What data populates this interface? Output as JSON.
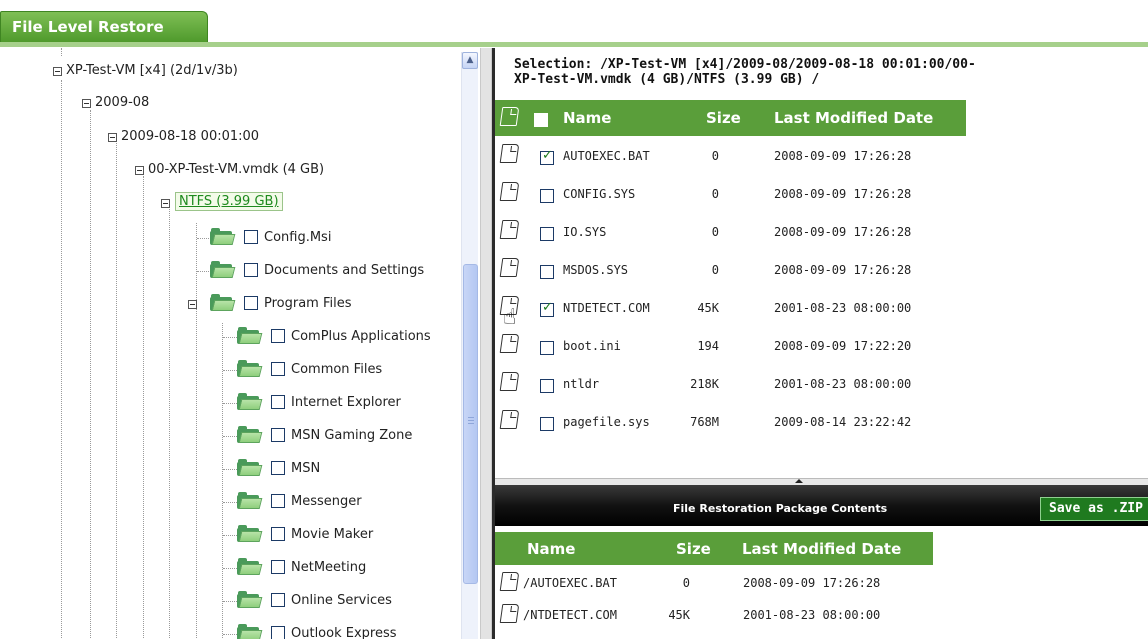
{
  "app": {
    "tab_label": "File Level Restore"
  },
  "tree": {
    "vm": "XP-Test-VM [x4] (2d/1v/3b)",
    "month": "2009-08",
    "snapshot": "2009-08-18 00:01:00",
    "disk": "00-XP-Test-VM.vmdk (4 GB)",
    "volume": "NTFS (3.99 GB)",
    "folders": [
      {
        "label": "Config.Msi"
      },
      {
        "label": "Documents and Settings"
      },
      {
        "label": "Program Files"
      }
    ],
    "subfolders": [
      {
        "label": "ComPlus Applications"
      },
      {
        "label": "Common Files"
      },
      {
        "label": "Internet Explorer"
      },
      {
        "label": "MSN Gaming Zone"
      },
      {
        "label": "MSN"
      },
      {
        "label": "Messenger"
      },
      {
        "label": "Movie Maker"
      },
      {
        "label": "NetMeeting"
      },
      {
        "label": "Online Services"
      },
      {
        "label": "Outlook Express"
      }
    ]
  },
  "selection": {
    "label": "Selection:",
    "path_line1": "/XP-Test-VM [x4]/2009-08/2009-08-18 00:01:00/00-",
    "path_line2": "XP-Test-VM.vmdk (4 GB)/NTFS (3.99 GB) /"
  },
  "file_table": {
    "columns": {
      "name": "Name",
      "size": "Size",
      "modified": "Last Modified Date"
    },
    "rows": [
      {
        "name": "AUTOEXEC.BAT",
        "size": "0",
        "modified": "2008-09-09 17:26:28",
        "checked": true
      },
      {
        "name": "CONFIG.SYS",
        "size": "0",
        "modified": "2008-09-09 17:26:28",
        "checked": false
      },
      {
        "name": "IO.SYS",
        "size": "0",
        "modified": "2008-09-09 17:26:28",
        "checked": false
      },
      {
        "name": "MSDOS.SYS",
        "size": "0",
        "modified": "2008-09-09 17:26:28",
        "checked": false
      },
      {
        "name": "NTDETECT.COM",
        "size": "45K",
        "modified": "2001-08-23 08:00:00",
        "checked": true
      },
      {
        "name": "boot.ini",
        "size": "194",
        "modified": "2008-09-09 17:22:20",
        "checked": false
      },
      {
        "name": "ntldr",
        "size": "218K",
        "modified": "2001-08-23 08:00:00",
        "checked": false
      },
      {
        "name": "pagefile.sys",
        "size": "768M",
        "modified": "2009-08-14 23:22:42",
        "checked": false
      }
    ]
  },
  "package": {
    "title": "File Restoration Package Contents",
    "save_button": "Save as .ZIP",
    "columns": {
      "name": "Name",
      "size": "Size",
      "modified": "Last Modified Date"
    },
    "rows": [
      {
        "name": "/AUTOEXEC.BAT",
        "size": "0",
        "modified": "2008-09-09 17:26:28"
      },
      {
        "name": "/NTDETECT.COM",
        "size": "45K",
        "modified": "2001-08-23 08:00:00"
      }
    ]
  },
  "colors": {
    "accent_green": "#5a9e3a",
    "tab_green": "#4f9a2c",
    "link_green": "#1e8a1e"
  },
  "icons": [
    "expand-collapse-icon",
    "folder-icon",
    "checkbox-icon",
    "document-icon",
    "hand-cursor-icon",
    "scroll-up-icon"
  ]
}
